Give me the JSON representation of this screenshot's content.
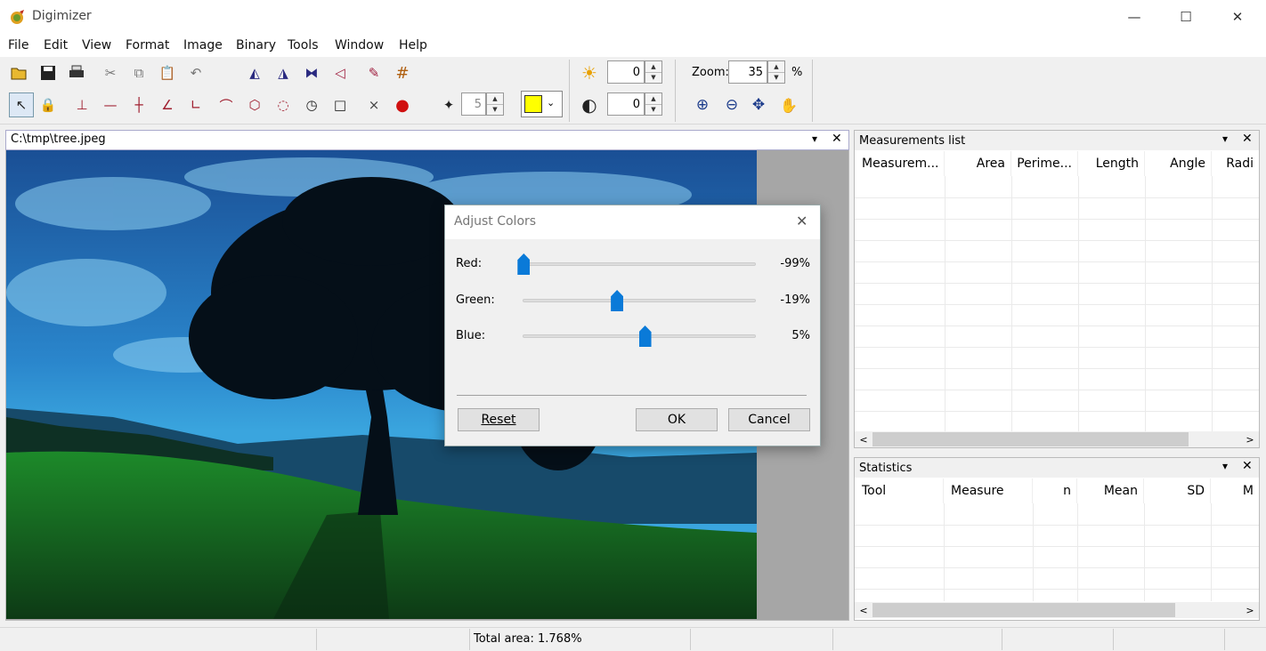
{
  "window": {
    "title": "Digimizer",
    "minimize": "—",
    "maximize": "☐",
    "close": "✕"
  },
  "menu": {
    "file": "File",
    "edit": "Edit",
    "view": "View",
    "format": "Format",
    "image": "Image",
    "binary": "Binary",
    "tools": "Tools",
    "window": "Window",
    "help": "Help"
  },
  "toolbar": {
    "brightness_value": "0",
    "contrast_value": "0",
    "wand_tolerance": "5",
    "zoom_label": "Zoom:",
    "zoom_value": "35",
    "zoom_unit": "%",
    "fill_color": "#ffff00"
  },
  "document": {
    "title": "C:\\tmp\\tree.jpeg",
    "menu_glyph": "▾",
    "close_glyph": "✕"
  },
  "measurements": {
    "title": "Measurements list",
    "columns": [
      "Measurem...",
      "Area",
      "Perime...",
      "Length",
      "Angle",
      "Radi"
    ]
  },
  "statistics": {
    "title": "Statistics",
    "columns": [
      "Tool",
      "Measure",
      "n",
      "Mean",
      "SD",
      "M"
    ]
  },
  "status": {
    "total_area": "Total area: 1.768%"
  },
  "dialog": {
    "title": "Adjust Colors",
    "close_glyph": "✕",
    "red_label": "Red:",
    "red_value": "-99%",
    "red_level": -99,
    "green_label": "Green:",
    "green_value": "-19%",
    "green_level": -19,
    "blue_label": "Blue:",
    "blue_value": "5%",
    "blue_level": 5,
    "reset_label": "Reset",
    "ok_label": "OK",
    "cancel_label": "Cancel"
  }
}
